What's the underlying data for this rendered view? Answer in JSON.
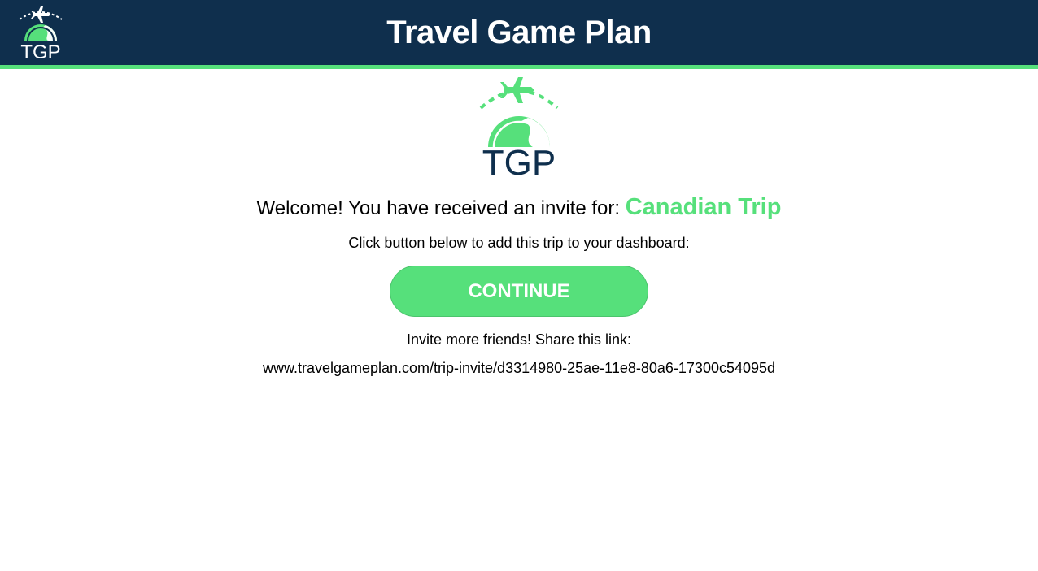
{
  "header": {
    "title": "Travel Game Plan",
    "logo_text": "TGP",
    "logo_icon": "airplane-globe-logo"
  },
  "main": {
    "logo_text": "TGP",
    "welcome_text": "Welcome! You have received an invite for: ",
    "trip_name": "Canadian Trip",
    "instruction": "Click button below to add this trip to your dashboard:",
    "continue_label": "CONTINUE",
    "share_text": "Invite more friends! Share this link:",
    "share_link": "www.travelgameplan.com/trip-invite/d3314980-25ae-11e8-80a6-17300c54095d"
  },
  "colors": {
    "header_bg": "#0f2f4d",
    "accent_green": "#56e07b",
    "logo_text_dark": "#0f2f4d"
  }
}
